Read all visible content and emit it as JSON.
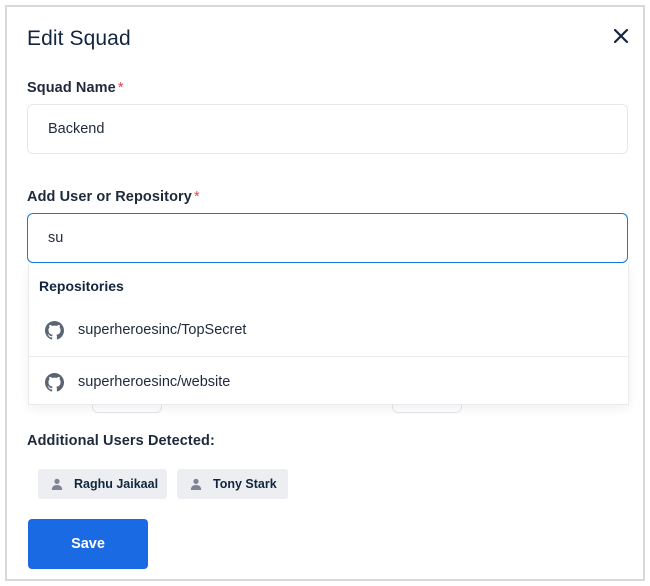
{
  "modal": {
    "title": "Edit Squad",
    "close_icon": "close-icon"
  },
  "squad_name": {
    "label": "Squad Name",
    "required_mark": "*",
    "value": "Backend"
  },
  "add_user_or_repo": {
    "label": "Add User or Repository",
    "required_mark": "*",
    "value": "su"
  },
  "dropdown": {
    "heading": "Repositories",
    "items": [
      {
        "icon": "github-icon",
        "label": "superheroesinc/TopSecret"
      },
      {
        "icon": "github-icon",
        "label": "superheroesinc/website"
      }
    ]
  },
  "additional_users": {
    "label": "Additional Users Detected:",
    "chips": [
      {
        "icon": "user-icon",
        "label": "Raghu Jaikaal"
      },
      {
        "icon": "user-icon",
        "label": "Tony Stark"
      }
    ]
  },
  "actions": {
    "save_label": "Save"
  },
  "colors": {
    "primary": "#1a6ae3",
    "focus_border": "#1a73e8",
    "required": "#e0434b",
    "text": "#13253f",
    "chip_bg": "#eceef1"
  }
}
